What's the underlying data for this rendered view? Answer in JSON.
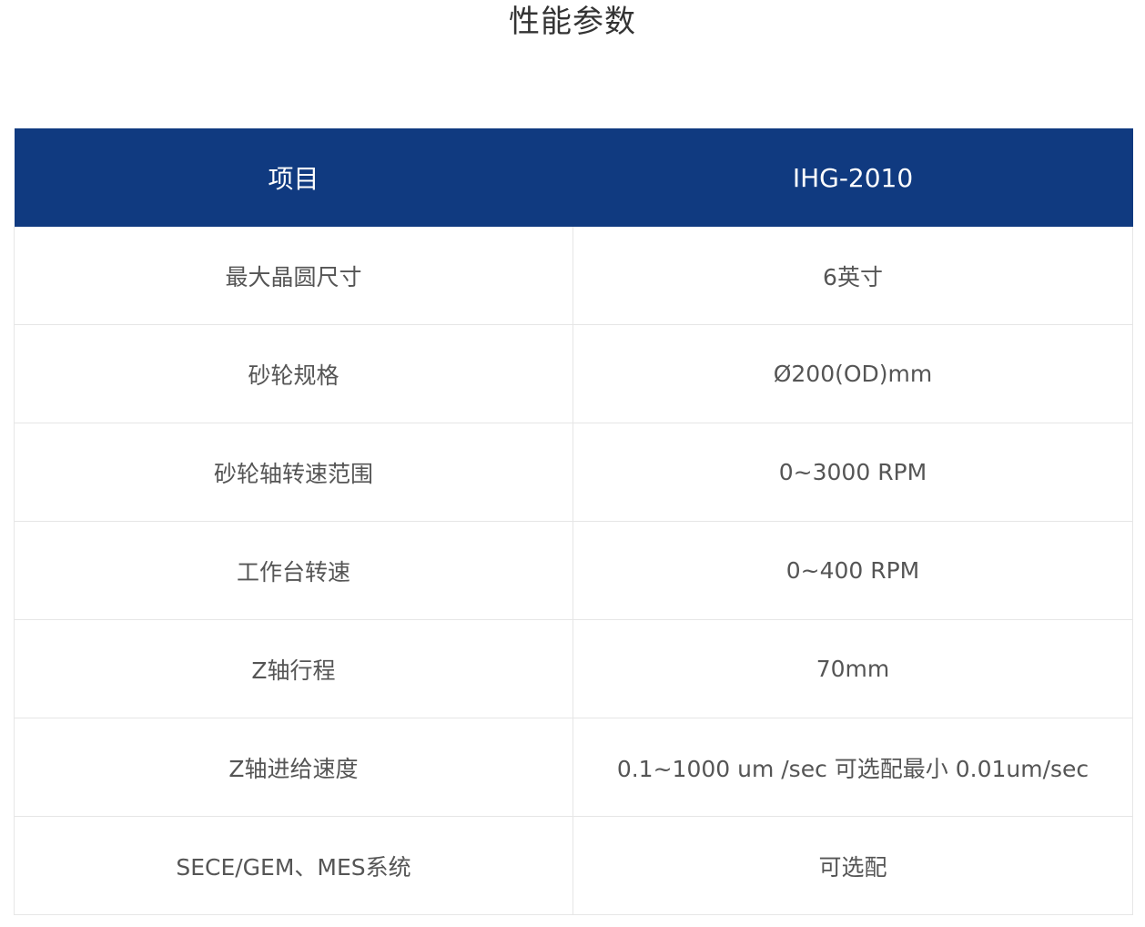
{
  "title": "性能参数",
  "table": {
    "headers": [
      "项目",
      "IHG-2010"
    ],
    "rows": [
      [
        "最大晶圆尺寸",
        "6英寸"
      ],
      [
        "砂轮规格",
        "Ø200(OD)mm"
      ],
      [
        "砂轮轴转速范围",
        "0~3000 RPM"
      ],
      [
        "工作台转速",
        "0~400 RPM"
      ],
      [
        "Z轴行程",
        "70mm"
      ],
      [
        "Z轴进给速度",
        "0.1~1000 um /sec 可选配最小 0.01um/sec"
      ],
      [
        "SECE/GEM、MES系统",
        "可选配"
      ]
    ]
  },
  "colors": {
    "header_bg": "#103a80",
    "header_text": "#ffffff",
    "cell_text": "#555555",
    "border": "#e6e6e6"
  }
}
